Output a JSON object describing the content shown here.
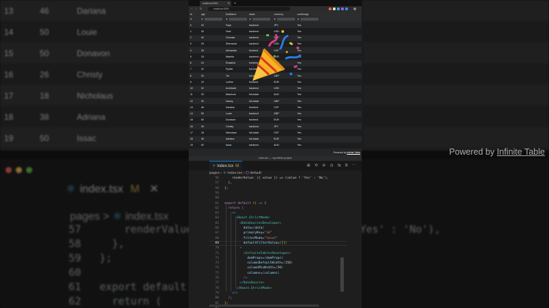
{
  "background": {
    "grid_rows": [
      {
        "id": "13",
        "age": "46",
        "name": "Dariana"
      },
      {
        "id": "14",
        "age": "50",
        "name": "Louie"
      },
      {
        "id": "15",
        "age": "50",
        "name": "Donavon"
      },
      {
        "id": "16",
        "age": "26",
        "name": "Christy"
      },
      {
        "id": "17",
        "age": "18",
        "name": "Nicholaus"
      },
      {
        "id": "18",
        "age": "38",
        "name": "Adriana"
      },
      {
        "id": "19",
        "age": "50",
        "name": "Issac"
      }
    ],
    "powered_by": "Powered by",
    "powered_link": "Infinite Table",
    "tab_label": "index.tsx",
    "tab_modified": "M",
    "close_glyph": "✕",
    "crumbs": "pages > ",
    "crumb_file": "index.tsx",
    "code": [
      {
        "num": "57",
        "text": "    renderValue: ({ value }) => (value ? 'Yes' : 'No'),"
      },
      {
        "num": "58",
        "text": "  },"
      },
      {
        "num": "59",
        "text": "};"
      },
      {
        "num": "60",
        "text": ""
      },
      {
        "num": "61",
        "text": "export default () => {"
      },
      {
        "num": "62",
        "text": "  return ("
      }
    ]
  },
  "browser": {
    "tab_title": "localhost:3000",
    "url": "localhost:3000",
    "columns": [
      "id",
      "age",
      "firstName",
      "stack",
      "currency",
      "canDesign"
    ],
    "filter_icon": "▼",
    "rows": [
      [
        "0",
        "24",
        "Faye",
        "backend",
        "JPY",
        "Yes"
      ],
      [
        "1",
        "40",
        "Noel",
        "backend",
        "USD",
        "Yes"
      ],
      [
        "2",
        "40",
        "Gonzalo",
        "backend",
        "GBP",
        "Yes"
      ],
      [
        "3",
        "25",
        "Sherwood",
        "backend",
        "USD",
        "Yes"
      ],
      [
        "4",
        "25",
        "Alexandre",
        "frontend",
        "CHF",
        "Yes"
      ],
      [
        "5",
        "15",
        "Mariela",
        "backend",
        "EUR",
        "Yes"
      ],
      [
        "6",
        "24",
        "Rosalind",
        "frontend",
        "GBP",
        "Yes"
      ],
      [
        "7",
        "32",
        "Pyotte",
        "full-stack",
        "CHF",
        "Yes"
      ],
      [
        "8",
        "30",
        "Tre",
        "full-stack",
        "GBP",
        "Yes"
      ],
      [
        "9",
        "10",
        "Lurline",
        "frontend",
        "EUR",
        "Yes"
      ],
      [
        "10",
        "32",
        "Archibald",
        "backend",
        "USD",
        "Yes"
      ],
      [
        "11",
        "33",
        "Mauricus",
        "full-stack",
        "AUD",
        "Yes"
      ],
      [
        "12",
        "30",
        "Danny",
        "full-stack",
        "GBP",
        "Yes"
      ],
      [
        "13",
        "46",
        "Dariana",
        "frontend",
        "CHF",
        "Yes"
      ],
      [
        "14",
        "50",
        "Louie",
        "backend",
        "GBP",
        "Yes"
      ],
      [
        "15",
        "50",
        "Donavon",
        "frontend",
        "EUR",
        "Yes"
      ],
      [
        "16",
        "26",
        "Christy",
        "backend",
        "JPY",
        "Yes"
      ],
      [
        "17",
        "18",
        "Nicholaus",
        "full-stack",
        "CHF",
        "Yes"
      ],
      [
        "18",
        "38",
        "Adriana",
        "full-stack",
        "EUR",
        "Yes"
      ],
      [
        "19",
        "50",
        "Issac",
        "backend",
        "AUD",
        "Yes"
      ]
    ],
    "powered_by": "Powered by",
    "powered_link": "Infinite Table"
  },
  "editor": {
    "window_title": "index.tsx — my-infinite-project",
    "tab_label": "index.tsx",
    "tab_modified": "M",
    "actions": "⊞ ⟲ ⊘ ◷ ⇆ ⌸ ⋯",
    "crumbs": [
      {
        "label": "pages"
      },
      {
        "label": "index.tsx"
      },
      {
        "label": "default"
      }
    ],
    "lines": [
      {
        "num": "56",
        "html": "<span>    renderValue: ({ value }) => (value ? 'Yes' : 'No'),</span>"
      },
      {
        "num": "57",
        "html": "<span>  },</span>"
      },
      {
        "num": "58",
        "html": "<span>};</span>"
      },
      {
        "num": "59",
        "html": ""
      },
      {
        "num": "60",
        "html": ""
      },
      {
        "num": "61",
        "html": "<span class='kw'>export default</span> <span class='pun'>()</span> <span class='kb'>=&gt;</span> <span class='pun'>{</span>"
      },
      {
        "num": "62",
        "html": "  <span class='kw'>return</span> <span class='br2'>(</span>"
      },
      {
        "num": "63",
        "html": "    <span class='kb'>&lt;&gt;</span>"
      },
      {
        "num": "64",
        "html": "      <span class='kb'>&lt;</span><span class='tag'>React.StrictMode</span><span class='kb'>&gt;</span>"
      },
      {
        "num": "65",
        "html": "        <span class='kb'>&lt;</span><span class='tag'>DataSource</span><span class='kb'>&lt;</span><span class='tag'>Developer</span><span class='kb'>&gt;</span>"
      },
      {
        "num": "66",
        "html": "          <span class='attr'>data</span>=<span class='kb'>{</span><span class='attr'>data</span><span class='kb'>}</span>"
      },
      {
        "num": "67",
        "html": "          <span class='attr'>primaryKey</span>=<span class='str'>\"id\"</span>"
      },
      {
        "num": "68",
        "html": "          <span class='attr'>filterMode</span>=<span class='str'>\"local\"</span>"
      },
      {
        "num": "69",
        "html": "          <span class='attr'>defaultFilterValue</span>=<span class='kb'>{</span><span class='pun'>[]</span><span class='kb'>}</span>"
      },
      {
        "num": "70",
        "html": "        <span class='kb'>&gt;</span>"
      },
      {
        "num": "71",
        "html": "          <span class='kb'>&lt;</span><span class='tag'>InfiniteTable</span><span class='kb'>&lt;</span><span class='tag'>Developer</span><span class='kb'>&gt;</span>"
      },
      {
        "num": "72",
        "html": "            <span class='attr'>domProps</span>=<span class='kb'>{</span><span class='attr'>domProps</span><span class='kb'>}</span>"
      },
      {
        "num": "73",
        "html": "            <span class='attr'>columnDefaultWidth</span>=<span class='kb'>{</span>150<span class='kb'>}</span>"
      },
      {
        "num": "74",
        "html": "            <span class='attr'>columnMinWidth</span>=<span class='kb'>{</span>50<span class='kb'>}</span>"
      },
      {
        "num": "75",
        "html": "            <span class='attr'>columns</span>=<span class='kb'>{</span><span class='attr'>columns</span><span class='kb'>}</span>"
      },
      {
        "num": "76",
        "html": "          <span class='kb'>/&gt;</span>"
      },
      {
        "num": "77",
        "html": "        <span class='kb'>&lt;/</span><span class='tag'>DataSource</span><span class='kb'>&gt;</span>"
      },
      {
        "num": "78",
        "html": "      <span class='kb'>&lt;/</span><span class='tag'>React.StrictMode</span><span class='kb'>&gt;</span>"
      },
      {
        "num": "79",
        "html": "    <span class='kb'>&lt;/&gt;</span>"
      },
      {
        "num": "80",
        "html": "  <span class='br2'>)</span>;"
      },
      {
        "num": "81",
        "html": "<span class='pun'>}</span>;"
      },
      {
        "num": "82",
        "html": ""
      }
    ],
    "current_line": "69"
  },
  "colors": {
    "accent": "#0e7ad1",
    "react_blue": "#4fb7e6",
    "traffic_red": "#ee5f57",
    "traffic_yellow": "#f4bd50",
    "traffic_green": "#5fc245"
  }
}
